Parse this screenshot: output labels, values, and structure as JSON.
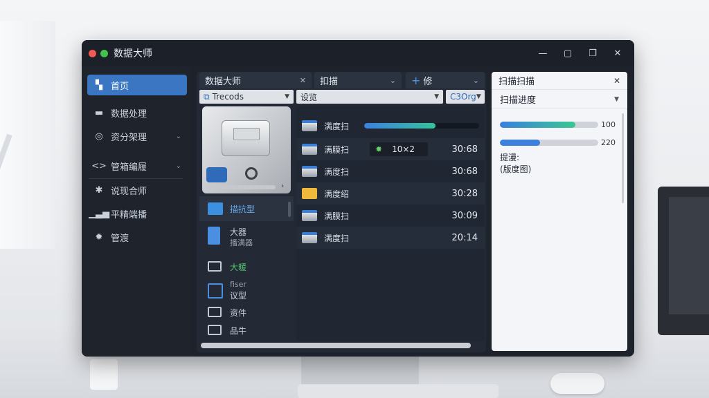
{
  "window": {
    "title": "数据大师",
    "controls": [
      "—",
      "▢",
      "❐",
      "✕"
    ]
  },
  "sidebar": {
    "items": [
      {
        "label": "首页",
        "icon": "home-icon",
        "active": true
      },
      {
        "label": "数据处理",
        "icon": "folder-icon"
      },
      {
        "label": "资分架理",
        "icon": "target-icon",
        "caret": "⌄"
      },
      {
        "label": "管箱编履",
        "icon": "code-icon",
        "caret": "⌄"
      },
      {
        "label": "说现合师",
        "icon": "gear-icon"
      },
      {
        "label": "平精端播",
        "icon": "chart-icon"
      },
      {
        "label": "管渡",
        "icon": "settings-icon"
      }
    ]
  },
  "tabs": [
    {
      "label": "数据大师",
      "close": "✕"
    },
    {
      "label": "扣描",
      "chevron": "⌄"
    },
    {
      "plus": "+",
      "label": "修",
      "chevron": "⌄"
    }
  ],
  "toolbars": {
    "left": {
      "label": "Trecods"
    },
    "mid": {
      "label": "设览"
    },
    "right": {
      "label": "C3Org"
    }
  },
  "files": [
    {
      "label": "描抗型",
      "type": "folder-blue",
      "style": "blue"
    },
    {
      "label": "大器",
      "sub": "播满器",
      "type": "doc-blue"
    },
    {
      "label": "大暖",
      "type": "folder-outline",
      "style": "green"
    },
    {
      "label": "fiser",
      "sub": "议型",
      "type": "doc-outline"
    },
    {
      "label": "资件",
      "type": "folder-outline"
    },
    {
      "label": "品牛",
      "type": "folder-outline"
    }
  ],
  "rows": [
    {
      "name": "满度扫",
      "progress": 0.62
    },
    {
      "name": "满膜扫",
      "chip": "10×2",
      "value": "30:68"
    },
    {
      "name": "满度扫",
      "value": "30:68"
    },
    {
      "name": "满度绍",
      "value": "30:28"
    },
    {
      "name": "满膜扫",
      "value": "30:09"
    },
    {
      "name": "满度扫",
      "value": "20:14"
    }
  ],
  "panel": {
    "title": "扫描扫描",
    "close": "✕",
    "select": "扫描进度",
    "bars": [
      {
        "fill": 0.77,
        "value": "100",
        "color": "g"
      },
      {
        "fill": 0.41,
        "value": "220",
        "color": "b"
      }
    ],
    "note_line1": "提漫:",
    "note_line2": "(版度图)"
  },
  "colors": {
    "accent": "#3a76c2",
    "progress_start": "#3d7fe0",
    "progress_end": "#34c49a",
    "folder_yellow": "#f0b93a"
  }
}
